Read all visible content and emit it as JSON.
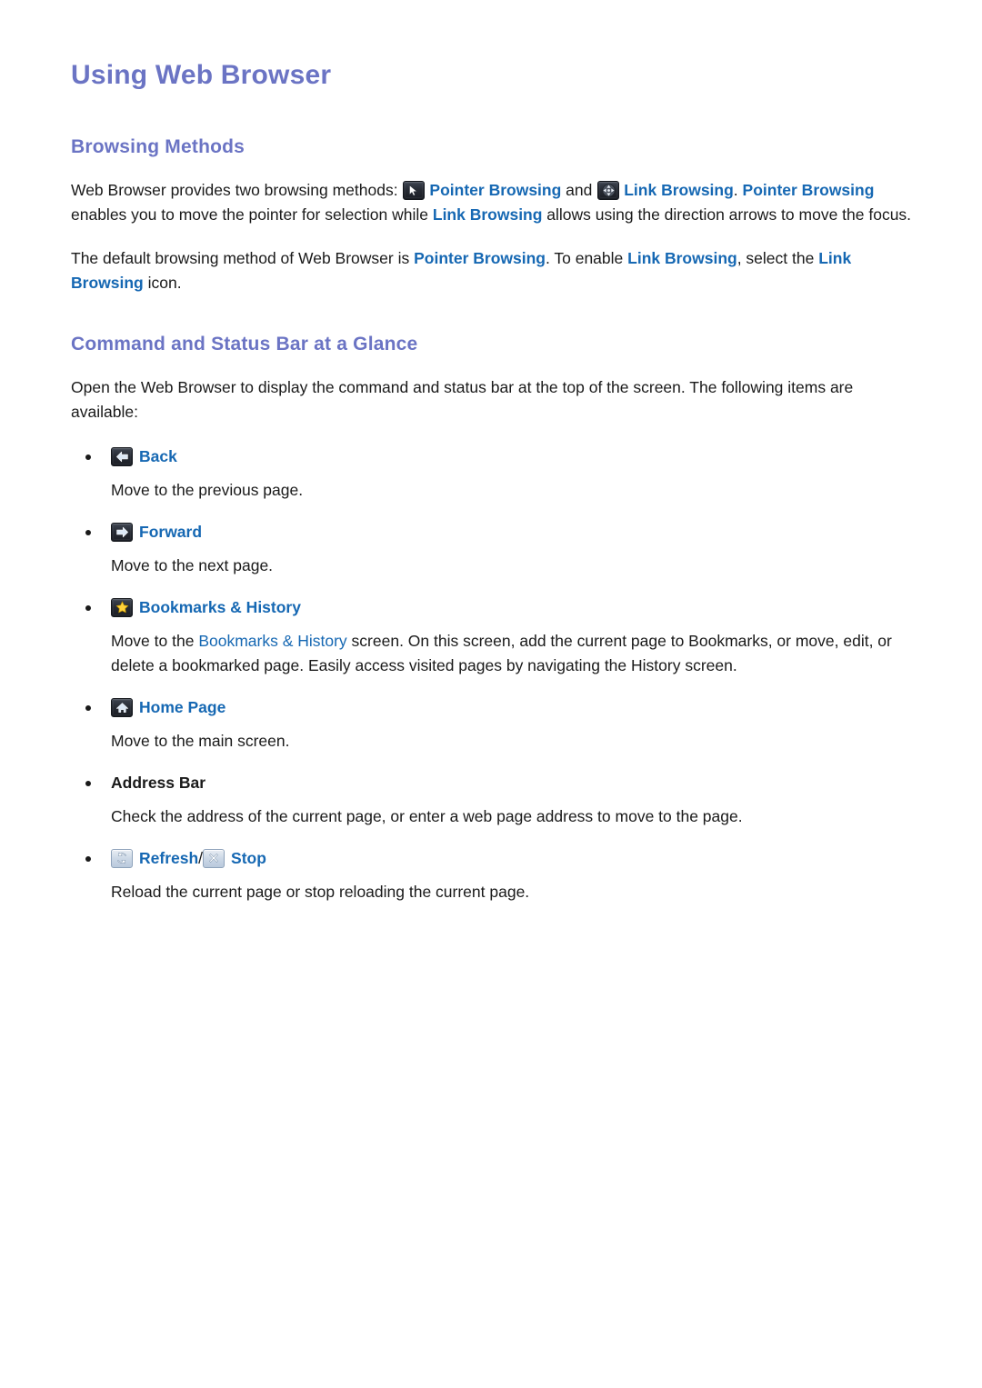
{
  "document": {
    "title": "Using Web Browser"
  },
  "sections": [
    {
      "id": "browsing-methods",
      "heading": "Browsing Methods",
      "paragraphs": [
        {
          "id": "p1",
          "runs": [
            {
              "text": "Web Browser provides two browsing methods: ",
              "style": "plain"
            },
            {
              "text": "",
              "style": "icon",
              "icon": "pointer-cursor-icon",
              "theme": "dark"
            },
            {
              "text": "Pointer Browsing",
              "style": "blue"
            },
            {
              "text": " and ",
              "style": "plain"
            },
            {
              "text": "",
              "style": "icon",
              "icon": "four-direction-arrows-icon",
              "theme": "dark"
            },
            {
              "text": "Link Browsing",
              "style": "blue"
            },
            {
              "text": ". ",
              "style": "plain"
            },
            {
              "text": "Pointer Browsing",
              "style": "blue"
            },
            {
              "text": " enables you to move the pointer for selection while ",
              "style": "plain"
            },
            {
              "text": "Link Browsing",
              "style": "blue"
            },
            {
              "text": " allows using the direction arrows to move the focus.",
              "style": "plain"
            }
          ]
        },
        {
          "id": "p2",
          "runs": [
            {
              "text": "The default browsing method of Web Browser is ",
              "style": "plain"
            },
            {
              "text": "Pointer Browsing",
              "style": "blue"
            },
            {
              "text": ". To enable ",
              "style": "plain"
            },
            {
              "text": "Link Browsing",
              "style": "blue"
            },
            {
              "text": ", select the ",
              "style": "plain"
            },
            {
              "text": "Link Browsing",
              "style": "blue"
            },
            {
              "text": " icon.",
              "style": "plain"
            }
          ]
        }
      ]
    },
    {
      "id": "command-and-status-bar",
      "heading": "Command and Status Bar at a Glance",
      "intro": "Open the Web Browser to display the command and status bar at the top of the screen. The following items are available:"
    }
  ],
  "command_items": [
    {
      "id": "back",
      "label": "Back",
      "label_color": "blue",
      "icons": [
        {
          "name": "arrow-left-icon",
          "theme": "dark"
        }
      ],
      "description_runs": [
        {
          "text": "Move to the previous page.",
          "style": "plain"
        }
      ]
    },
    {
      "id": "forward",
      "label": "Forward",
      "label_color": "blue",
      "icons": [
        {
          "name": "arrow-right-icon",
          "theme": "dark"
        }
      ],
      "description_runs": [
        {
          "text": "Move to the next page.",
          "style": "plain"
        }
      ]
    },
    {
      "id": "bookmarks-history",
      "label": "Bookmarks & History",
      "label_color": "blue",
      "icons": [
        {
          "name": "star-icon",
          "theme": "dark"
        }
      ],
      "description_runs": [
        {
          "text": "Move to the ",
          "style": "plain"
        },
        {
          "text": "Bookmarks & History",
          "style": "blue-plain"
        },
        {
          "text": " screen. On this screen, add the current page to Bookmarks, or move, edit, or delete a bookmarked page. Easily access visited pages by navigating the History screen.",
          "style": "plain"
        }
      ]
    },
    {
      "id": "home-page",
      "label": "Home Page",
      "label_color": "blue",
      "icons": [
        {
          "name": "home-icon",
          "theme": "dark"
        }
      ],
      "description_runs": [
        {
          "text": "Move to the main screen.",
          "style": "plain"
        }
      ]
    },
    {
      "id": "address-bar",
      "label": "Address Bar",
      "label_color": "black",
      "icons": [],
      "description_runs": [
        {
          "text": "Check the address of the current page, or enter a web page address to move to the page.",
          "style": "plain"
        }
      ]
    },
    {
      "id": "refresh-stop",
      "label": "Refresh",
      "label_color": "blue",
      "separator": " / ",
      "label2": "Stop",
      "icons": [
        {
          "name": "refresh-icon",
          "theme": "light"
        },
        {
          "name": "close-x-icon",
          "theme": "light"
        }
      ],
      "description_runs": [
        {
          "text": "Reload the current page or stop reloading the current page.",
          "style": "plain"
        }
      ]
    }
  ],
  "colors": {
    "title_purple": "#6b74c4",
    "link_blue": "#1668b3",
    "body_black": "#1a1a1a",
    "star_yellow": "#ffd23a",
    "icon_light_glyph": "#dbe8f5"
  }
}
